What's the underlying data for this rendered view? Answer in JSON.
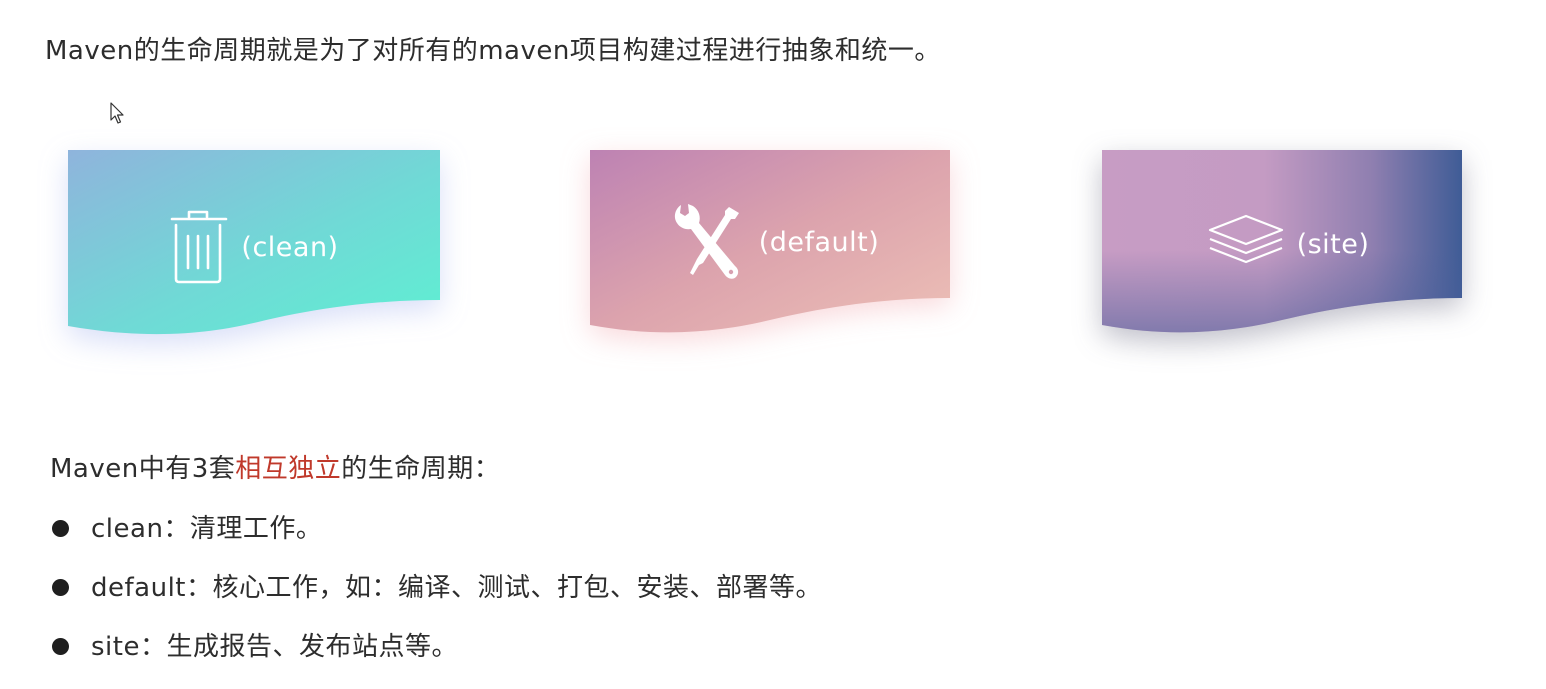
{
  "intro_text": "Maven的生命周期就是为了对所有的maven项目构建过程进行抽象和统一。",
  "cards": [
    {
      "label": "(clean)",
      "icon": "trash-icon",
      "colors": [
        "#8fb4dc",
        "#5ef0d2"
      ]
    },
    {
      "label": "(default)",
      "icon": "tools-icon",
      "colors": [
        "#bd82b3",
        "#edc0b6"
      ]
    },
    {
      "label": "(site)",
      "icon": "layers-icon",
      "colors": [
        "#c79cc4",
        "#3f5c96"
      ]
    }
  ],
  "section": {
    "title_before": "Maven中有3套",
    "title_highlight": "相互独立",
    "title_after": "的生命周期：",
    "highlight_color": "#c0392b"
  },
  "lifecycles": [
    {
      "text": "clean：清理工作。"
    },
    {
      "text": "default：核心工作，如：编译、测试、打包、安装、部署等。"
    },
    {
      "text": "site：生成报告、发布站点等。"
    }
  ]
}
